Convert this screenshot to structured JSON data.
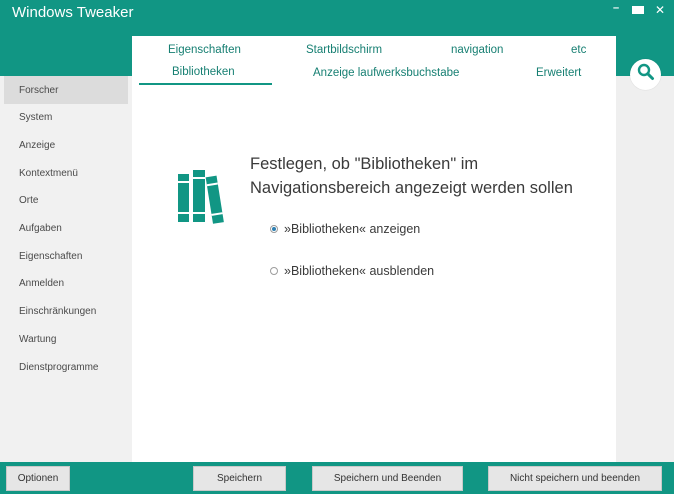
{
  "window": {
    "title": "Windows Tweaker",
    "controls": {
      "minimize": "–",
      "close": "✕"
    }
  },
  "sidebar": {
    "items": [
      {
        "label": "Forscher",
        "active": true
      },
      {
        "label": "System"
      },
      {
        "label": "Anzeige"
      },
      {
        "label": "Kontextmenü"
      },
      {
        "label": "Orte"
      },
      {
        "label": "Aufgaben"
      },
      {
        "label": "Eigenschaften"
      },
      {
        "label": "Anmelden"
      },
      {
        "label": "Einschränkungen"
      },
      {
        "label": "Wartung"
      },
      {
        "label": "Dienstprogramme"
      }
    ]
  },
  "tabs": {
    "row1": [
      "Eigenschaften",
      "Startbildschirm",
      "navigation",
      "etc"
    ],
    "row2": [
      "Bibliotheken",
      "Anzeige laufwerksbuchstabe",
      "Erweitert"
    ],
    "active": "Bibliotheken"
  },
  "icons": {
    "search": "search-icon",
    "libraries": "books-icon"
  },
  "main": {
    "heading": "Festlegen, ob \"Bibliotheken\" im Navigationsbereich angezeigt werden sollen",
    "options": [
      {
        "label": "»Bibliotheken« anzeigen",
        "checked": true
      },
      {
        "label": "»Bibliotheken« ausblenden",
        "checked": false
      }
    ]
  },
  "footer": {
    "options": "Optionen",
    "save": "Speichern",
    "save_exit": "Speichern und Beenden",
    "nosave_exit": "Nicht speichern und beenden"
  },
  "colors": {
    "accent": "#119684",
    "tab_text": "#167f72",
    "sidebar_bg": "#f1f1f1",
    "active_item_bg": "#dcdcdc",
    "radio_dot": "#2d7fb2"
  }
}
